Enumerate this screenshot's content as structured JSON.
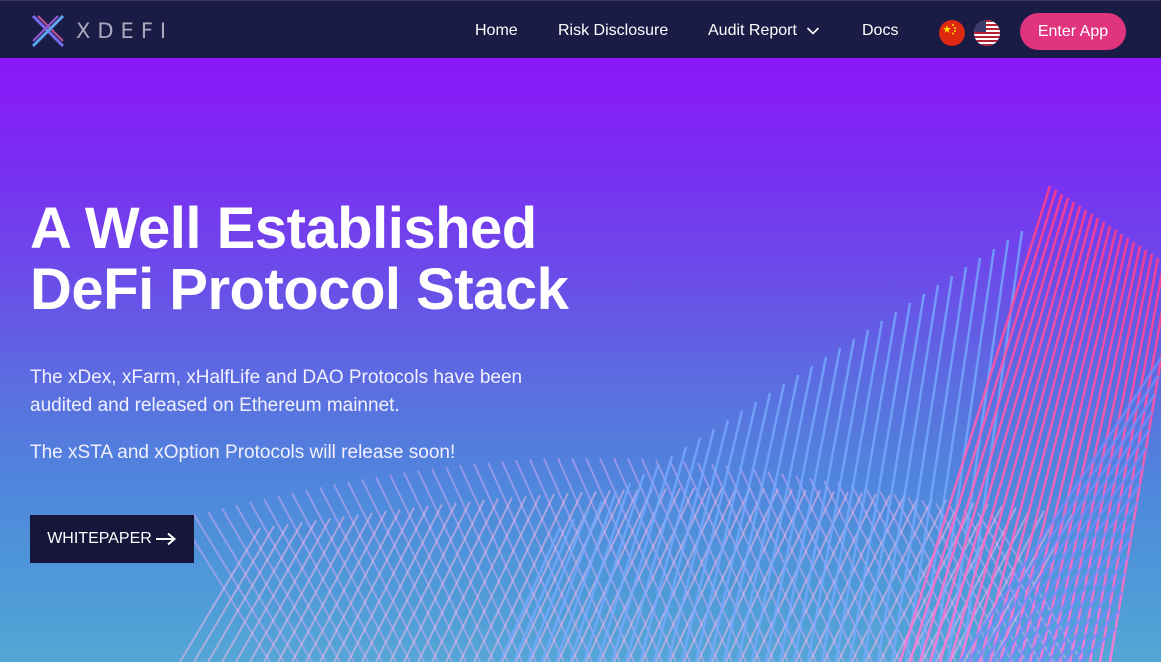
{
  "brand": {
    "name": "XDEFI"
  },
  "nav": {
    "home": "Home",
    "risk": "Risk Disclosure",
    "audit": "Audit Report",
    "docs": "Docs",
    "enter_app": "Enter App"
  },
  "icons": {
    "logo": "xdefi-logo-icon",
    "audit_dropdown": "chevron-down-icon",
    "lang_cn": "china-flag-icon",
    "lang_us": "usa-flag-icon",
    "whitepaper_arrow": "arrow-right-icon"
  },
  "hero": {
    "title_line1": "A Well Established",
    "title_line2": "DeFi Protocol Stack",
    "paragraph1": "The xDex, xFarm, xHalfLife and DAO Protocols have been audited and released on Ethereum mainnet.",
    "paragraph2": "The xSTA and xOption Protocols will release soon!",
    "whitepaper": "WHITEPAPER"
  },
  "colors": {
    "navbar": "#1b1c46",
    "accent": "#e0347f",
    "gradient_top": "#8a17f8",
    "gradient_bottom": "#55a6d6",
    "button_dark": "#15163a"
  }
}
